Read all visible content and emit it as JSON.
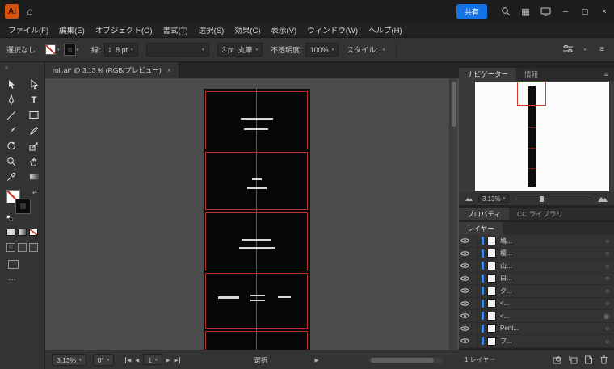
{
  "colors": {
    "accent_blue": "#1473e6",
    "artboard_red": "#b5352a",
    "layer_color_blue": "#3f86e0",
    "canvas_gray": "#4c4c4c"
  },
  "icons": {
    "home": "⌂",
    "workspace_grid": "▦",
    "minimize": "─",
    "maximize": "▢",
    "close": "×",
    "tab_close": "×",
    "chevron_down": "▾",
    "spinner_up": "▴",
    "spinner_down": "▾",
    "menu": "≡",
    "swap_colors": "⇄",
    "more": "…",
    "collapse": "«",
    "nav_prev": "◀",
    "nav_next": "▶",
    "status_expand": "▶",
    "type_tool": "T"
  },
  "titlebar": {
    "app_initials": "Ai",
    "share_label": "共有"
  },
  "menubar": {
    "items": [
      "ファイル(F)",
      "編集(E)",
      "オブジェクト(O)",
      "書式(T)",
      "選択(S)",
      "効果(C)",
      "表示(V)",
      "ウィンドウ(W)",
      "ヘルプ(H)"
    ]
  },
  "controlbar": {
    "selection_label": "選択なし",
    "stroke_label": "線:",
    "stroke_weight": "8 pt",
    "brush_name": "3 pt. 丸筆",
    "opacity_label": "不透明度:",
    "opacity_value": "100%",
    "style_label": "スタイル:"
  },
  "document_tab": {
    "title": "roll.ai* @ 3.13 % (RGB/プレビュー)"
  },
  "statusbar": {
    "zoom": "3.13%",
    "rotation": "0°",
    "artboard_number": "1",
    "tool_label": "選択"
  },
  "navigator": {
    "tab_active": "ナビゲーター",
    "tab_inactive": "情報",
    "zoom_value": "3.13%"
  },
  "properties": {
    "tab_active": "プロパティ",
    "tab_inactive": "CC ライブラリ"
  },
  "layers": {
    "tab_label": "レイヤー",
    "rows": [
      {
        "name": "鳩...",
        "target": "○"
      },
      {
        "name": "榎...",
        "target": "○"
      },
      {
        "name": "山...",
        "target": "○"
      },
      {
        "name": "白...",
        "target": "○"
      },
      {
        "name": "ク...",
        "target": "○"
      },
      {
        "name": "<...",
        "target": "○"
      },
      {
        "name": "<...",
        "target": "◎"
      },
      {
        "name": "Pent...",
        "target": "○"
      },
      {
        "name": "ブ...",
        "target": "○"
      }
    ],
    "footer_label": "1 レイヤー"
  }
}
